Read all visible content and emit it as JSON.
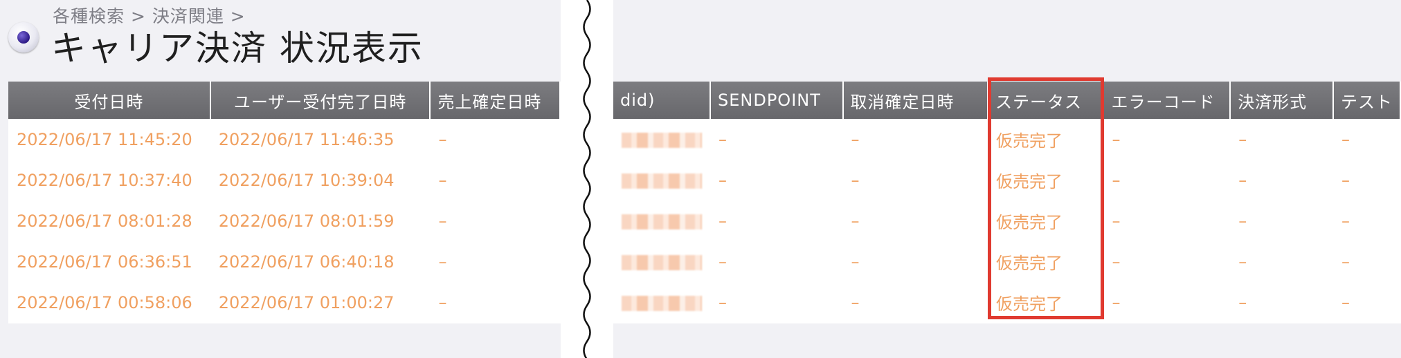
{
  "breadcrumb": "各種検索 > 決済関連 >",
  "title": "キャリア決済 状況表示",
  "left_table": {
    "headers": [
      "受付日時",
      "ユーザー受付完了日時",
      "売上確定日時"
    ],
    "rows": [
      [
        "2022/06/17 11:45:20",
        "2022/06/17 11:46:35",
        "–"
      ],
      [
        "2022/06/17 10:37:40",
        "2022/06/17 10:39:04",
        "–"
      ],
      [
        "2022/06/17 08:01:28",
        "2022/06/17 08:01:59",
        "–"
      ],
      [
        "2022/06/17 06:36:51",
        "2022/06/17 06:40:18",
        "–"
      ],
      [
        "2022/06/17 00:58:06",
        "2022/06/17 01:00:27",
        "–"
      ]
    ]
  },
  "right_table": {
    "headers": [
      "did)",
      "SENDPOINT",
      "取消確定日時",
      "ステータス",
      "エラーコード",
      "決済形式",
      "テスト"
    ],
    "rows": [
      [
        "–",
        "–",
        "仮売完了",
        "–",
        "–",
        "–"
      ],
      [
        "–",
        "–",
        "仮売完了",
        "–",
        "–",
        "–"
      ],
      [
        "–",
        "–",
        "仮売完了",
        "–",
        "–",
        "–"
      ],
      [
        "–",
        "–",
        "仮売完了",
        "–",
        "–",
        "–"
      ],
      [
        "–",
        "–",
        "仮売完了",
        "–",
        "–",
        "–"
      ]
    ]
  },
  "colors": {
    "cell_text": "#f0a060",
    "header_bg": "#727276",
    "highlight": "#e03a30"
  }
}
